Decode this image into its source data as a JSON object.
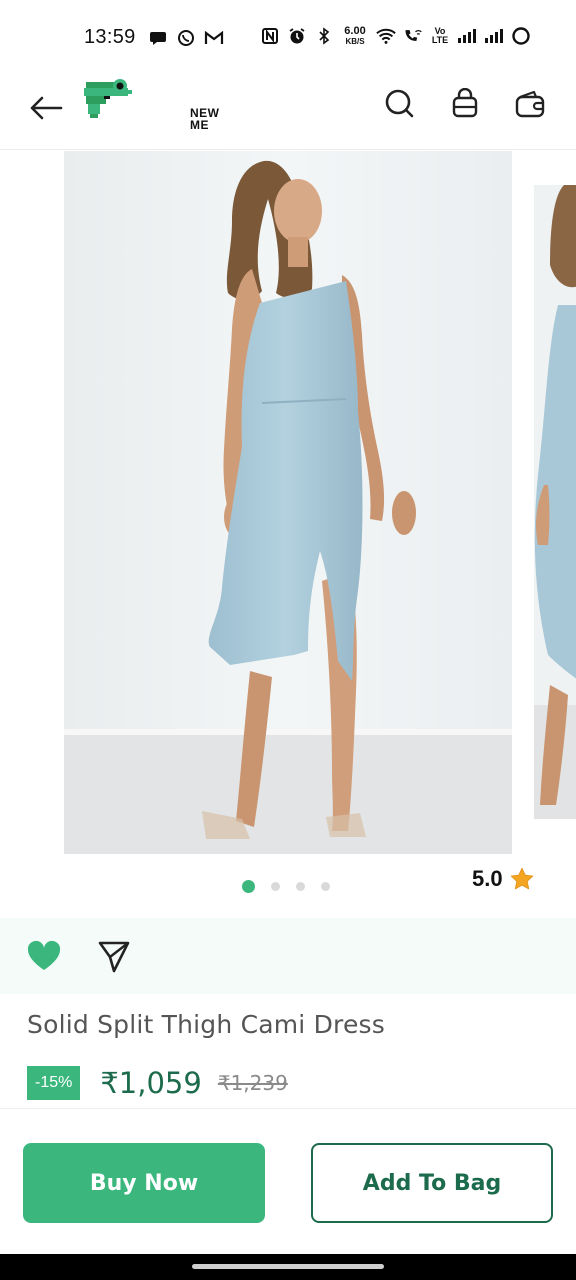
{
  "status_bar": {
    "time": "13:59",
    "net_speed_value": "6.00",
    "net_speed_unit": "KB/S",
    "volte_top": "Vo",
    "volte_bottom": "LTE",
    "left_icons": [
      "chat-bubble-icon",
      "whatsapp-icon",
      "gmail-icon"
    ],
    "right_icons": [
      "nfc-icon",
      "alarm-icon",
      "bluetooth-icon",
      "wifi-icon",
      "wifi-calling-icon",
      "signal-icon",
      "signal-icon",
      "battery-icon"
    ]
  },
  "header": {
    "brand_name": "NEW ME",
    "icons": [
      "search-icon",
      "bag-icon",
      "wallet-icon"
    ]
  },
  "product": {
    "title": "Solid Split Thigh Cami Dress",
    "rating": "5.0",
    "discount": "-15%",
    "price": "₹1,059",
    "mrp": "₹1,239",
    "image_count": 4,
    "active_image_index": 0
  },
  "actions": {
    "buy_now": "Buy Now",
    "add_to_bag": "Add To Bag"
  },
  "colors": {
    "accent": "#3bb77e",
    "accent_dark": "#1d6b4d",
    "dress": "#a8c8d8",
    "star": "#f4a623"
  }
}
